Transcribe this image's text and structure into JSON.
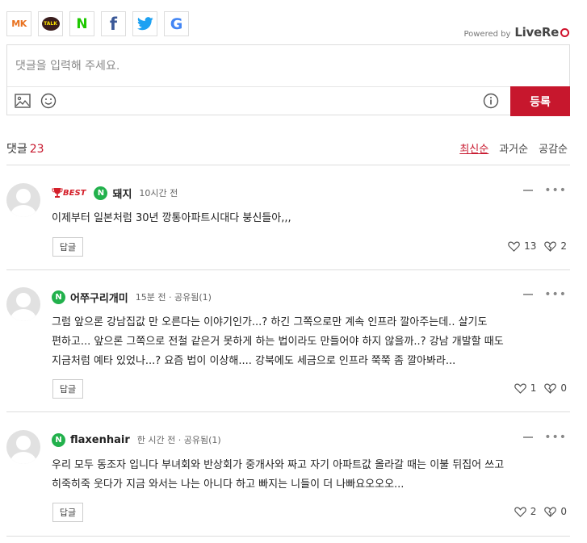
{
  "login": {
    "providers": [
      {
        "name": "MK",
        "label": "MK"
      },
      {
        "name": "Kakao",
        "label": "TALK"
      },
      {
        "name": "Naver",
        "label": "N"
      },
      {
        "name": "Facebook",
        "label": "f"
      },
      {
        "name": "Twitter",
        "label": ""
      },
      {
        "name": "Google",
        "label": "G"
      }
    ]
  },
  "powered_by": {
    "text": "Powered by",
    "brand": "LiveRe"
  },
  "editor": {
    "placeholder": "댓글을 입력해 주세요.",
    "submit_label": "등록",
    "image_icon": "image-icon",
    "emoji_icon": "smile-icon",
    "info_icon": "info-icon"
  },
  "comments_header": {
    "label": "댓글",
    "count": "23",
    "sort": [
      "최신순",
      "과거순",
      "공감순"
    ],
    "active_sort": "최신순"
  },
  "comments": [
    {
      "best": true,
      "best_label": "BEST",
      "author": "돼지",
      "time": "10시간 전",
      "text_lines": [
        "이제부터 일본처럼 30년 깡통아파트시대다 붕신들아,,,"
      ],
      "reply_label": "답글",
      "likes": "13",
      "dislikes": "2"
    },
    {
      "best": false,
      "author": "어쭈구리개미",
      "time": "15분 전 · 공유됨(1)",
      "text_lines": [
        "그럼 앞으론 강남집값 만 오른다는 이야기인가...? 하긴 그쪽으로만 계속 인프라 깔아주는데.. 살기도",
        "편하고... 앞으론 그쪽으로 전철 같은거 못하게 하는 법이라도 만들어야 하지 않을까..? 강남 개발할 때도",
        "지금처럼 예타 있었나...? 요즘 법이 이상해.... 강북에도 세금으로 인프라 쭉쭉 좀 깔아봐라..."
      ],
      "reply_label": "답글",
      "likes": "1",
      "dislikes": "0"
    },
    {
      "best": false,
      "author": "flaxenhair",
      "time": "한 시간 전 · 공유됨(1)",
      "text_lines": [
        "우리 모두 동조자 입니다 부녀회와 반상회가 중개사와 짜고 자기 아파트값 올라갈 때는 이불 뒤집어 쓰고",
        "히죽히죽 웃다가 지금 와서는 나는 아니다 하고 빠지는 니들이 더 나빠요오오오..."
      ],
      "reply_label": "답글",
      "likes": "2",
      "dislikes": "0"
    }
  ],
  "colors": {
    "accent": "#c7172d",
    "naver": "#22b14c",
    "best": "#d41f2a"
  }
}
